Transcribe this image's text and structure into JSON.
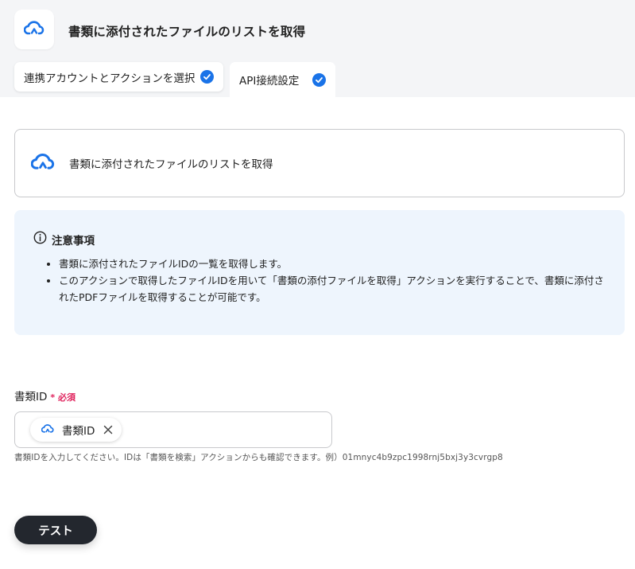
{
  "header": {
    "app_icon": "cloud-sync-icon",
    "title": "書類に添付されたファイルのリストを取得"
  },
  "tabs": [
    {
      "label": "連携アカウントとアクションを選択",
      "completed": true
    },
    {
      "label": "API接続設定",
      "completed": true,
      "active": true
    }
  ],
  "action_card": {
    "icon": "cloud-sync-icon",
    "label": "書類に添付されたファイルのリストを取得"
  },
  "notice": {
    "icon": "info-icon",
    "title": "注意事項",
    "items": [
      "書類に添付されたファイルIDの一覧を取得します。",
      "このアクションで取得したファイルIDを用いて「書類の添付ファイルを取得」アクションを実行することで、書類に添付されたPDFファイルを取得することが可能です。"
    ]
  },
  "field": {
    "label": "書類ID",
    "required_mark": "*",
    "required_text": "必須",
    "chip_label": "書類ID",
    "help": "書類IDを入力してください。IDは「書類を検索」アクションからも確認できます。例）01mnyc4b9zpc1998rnj5bxj3y3cvrgp8"
  },
  "buttons": {
    "test": "テスト"
  },
  "colors": {
    "accent": "#1a73e8",
    "required": "#e0245e",
    "notice_bg": "#eef5fd",
    "button_bg": "#23272e"
  }
}
